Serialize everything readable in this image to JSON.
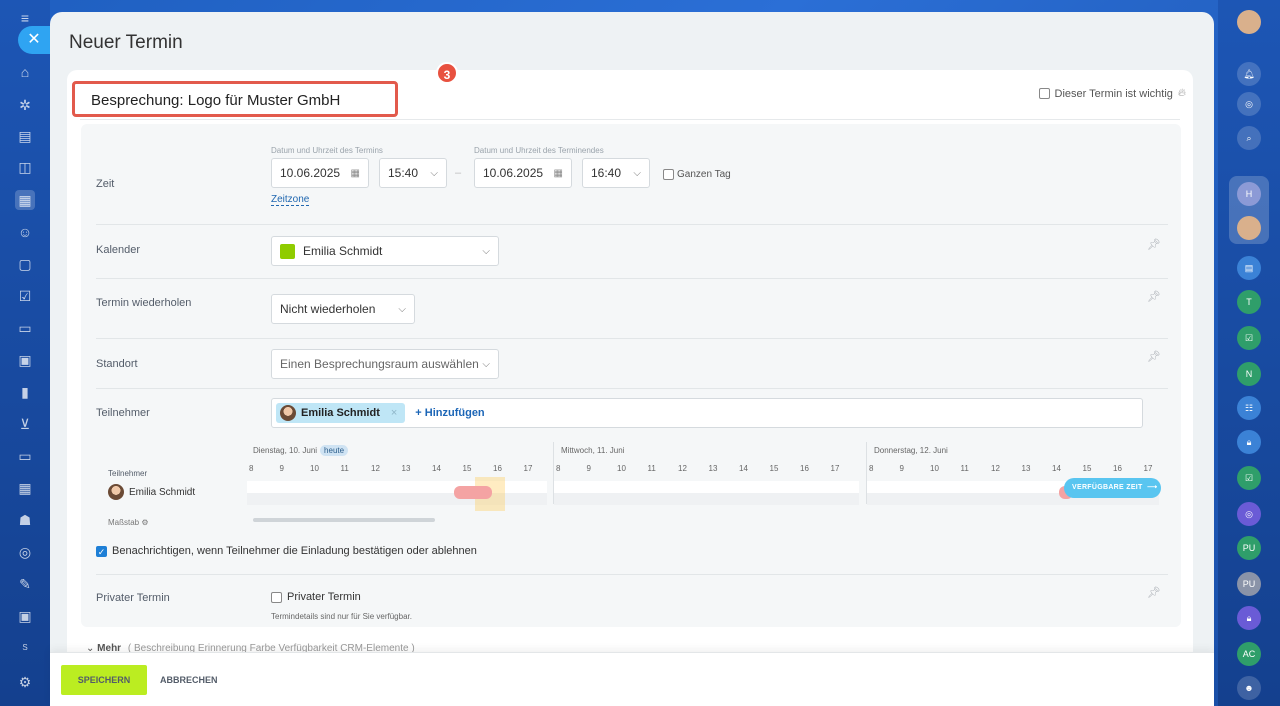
{
  "window": {
    "title": "Neuer Termin",
    "close_icon": "close-icon"
  },
  "subject": {
    "value": "Besprechung: Logo für Muster GmbH",
    "badge": "3"
  },
  "important": {
    "label": "Dieser Termin ist wichtig",
    "checked": false
  },
  "zeit": {
    "label": "Zeit",
    "start_caption": "Datum und Uhrzeit des Termins",
    "end_caption": "Datum und Uhrzeit des Terminendes",
    "start_date": "10.06.2025",
    "start_time": "15:40",
    "end_date": "10.06.2025",
    "end_time": "16:40",
    "dash": "–",
    "all_day_label": "Ganzen Tag",
    "timezone_link": "Zeitzone"
  },
  "kalender": {
    "label": "Kalender",
    "value": "Emilia Schmidt",
    "color": "#8fcc00"
  },
  "wiederholen": {
    "label": "Termin wiederholen",
    "value": "Nicht wiederholen"
  },
  "standort": {
    "label": "Standort",
    "value": "Einen Besprechungsraum auswählen"
  },
  "teilnehmer": {
    "label": "Teilnehmer",
    "chip": "Emilia Schmidt",
    "chip_remove": "×",
    "add_label": "+ Hinzufügen"
  },
  "timeline": {
    "participants_label": "Teilnehmer",
    "participant": "Emilia Schmidt",
    "scale_label": "Maßstab",
    "days": [
      {
        "label": "Dienstag, 10. Juni",
        "today": "heute",
        "hours": [
          "8",
          "9",
          "10",
          "11",
          "12",
          "13",
          "14",
          "15",
          "16",
          "17"
        ]
      },
      {
        "label": "Mittwoch, 11. Juni",
        "hours": [
          "8",
          "9",
          "10",
          "11",
          "12",
          "13",
          "14",
          "15",
          "16",
          "17"
        ]
      },
      {
        "label": "Donnerstag, 12. Juni",
        "hours": [
          "8",
          "9",
          "10",
          "11",
          "12",
          "13",
          "14",
          "15",
          "16",
          "17"
        ]
      }
    ],
    "available_button": "VERFÜGBARE ZEIT"
  },
  "notify": {
    "label": "Benachrichtigen, wenn Teilnehmer die Einladung bestätigen oder ablehnen",
    "checked": true
  },
  "privat": {
    "label": "Privater Termin",
    "checkbox_label": "Privater Termin",
    "hint": "Termindetails sind nur für Sie verfügbar."
  },
  "mehr": {
    "label": "Mehr",
    "items": "( Beschreibung  Erinnerung  Farbe  Verfügbarkeit  CRM-Elemente )"
  },
  "footer": {
    "save": "SPEICHERN",
    "cancel": "ABBRECHEN"
  },
  "right_sidebar": {
    "initials": [
      "H",
      "T",
      "N",
      "PU",
      "PU",
      "AC"
    ]
  },
  "left_sidebar": {
    "badge": "S"
  }
}
